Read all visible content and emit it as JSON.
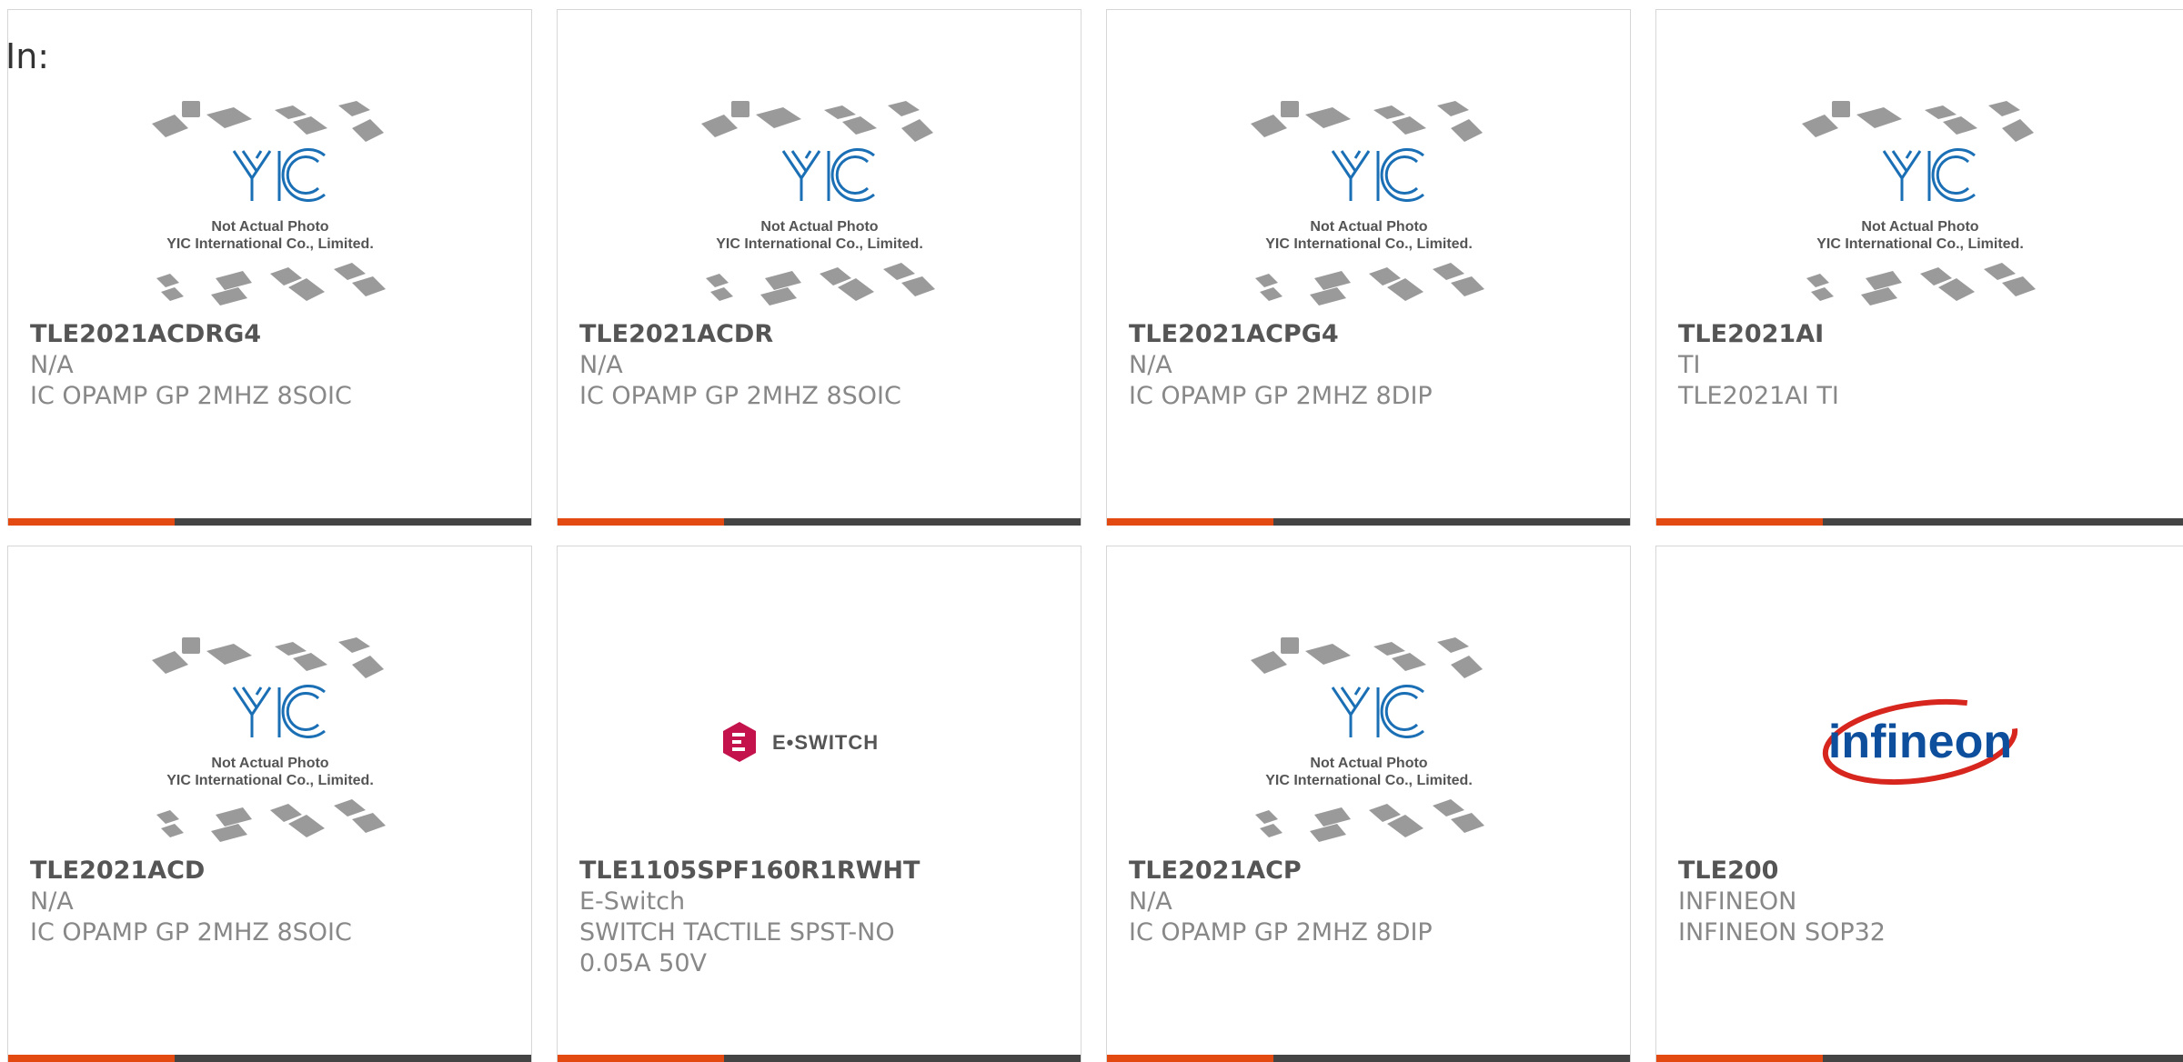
{
  "header": {
    "label": "In:"
  },
  "cards": [
    {
      "part": "TLE2021ACDRG4",
      "manufacturer": "N/A",
      "description": "IC OPAMP GP 2MHZ 8SOIC",
      "image": "yic-placeholder",
      "image_caption_1": "Not Actual Photo",
      "image_caption_2": "YIC International Co., Limited."
    },
    {
      "part": "TLE2021ACDR",
      "manufacturer": "N/A",
      "description": "IC OPAMP GP 2MHZ 8SOIC",
      "image": "yic-placeholder",
      "image_caption_1": "Not Actual Photo",
      "image_caption_2": "YIC International Co., Limited."
    },
    {
      "part": "TLE2021ACPG4",
      "manufacturer": "N/A",
      "description": "IC OPAMP GP 2MHZ 8DIP",
      "image": "yic-placeholder",
      "image_caption_1": "Not Actual Photo",
      "image_caption_2": "YIC International Co., Limited."
    },
    {
      "part": "TLE2021AI",
      "manufacturer": "TI",
      "description": "TLE2021AI TI",
      "image": "yic-placeholder",
      "image_caption_1": "Not Actual Photo",
      "image_caption_2": "YIC International Co., Limited."
    },
    {
      "part": "TLE2021ACD",
      "manufacturer": "N/A",
      "description": "IC OPAMP GP 2MHZ 8SOIC",
      "image": "yic-placeholder",
      "image_caption_1": "Not Actual Photo",
      "image_caption_2": "YIC International Co., Limited."
    },
    {
      "part": "TLE1105SPF160R1RWHT",
      "manufacturer": "E-Switch",
      "description": "SWITCH TACTILE SPST-NO 0.05A 50V",
      "image": "e-switch-logo",
      "logo_text": "E•SWITCH"
    },
    {
      "part": "TLE2021ACP",
      "manufacturer": "N/A",
      "description": "IC OPAMP GP 2MHZ 8DIP",
      "image": "yic-placeholder",
      "image_caption_1": "Not Actual Photo",
      "image_caption_2": "YIC International Co., Limited."
    },
    {
      "part": "TLE200",
      "manufacturer": "INFINEON",
      "description": "INFINEON SOP32",
      "image": "infineon-logo",
      "logo_text": "infineon"
    }
  ],
  "colors": {
    "accent": "#e24a12",
    "bar": "#444444",
    "yic_blue": "#1b6fb5",
    "eswitch_red": "#c4124d",
    "infineon_blue": "#0d4f9c",
    "infineon_red": "#d7261e"
  }
}
